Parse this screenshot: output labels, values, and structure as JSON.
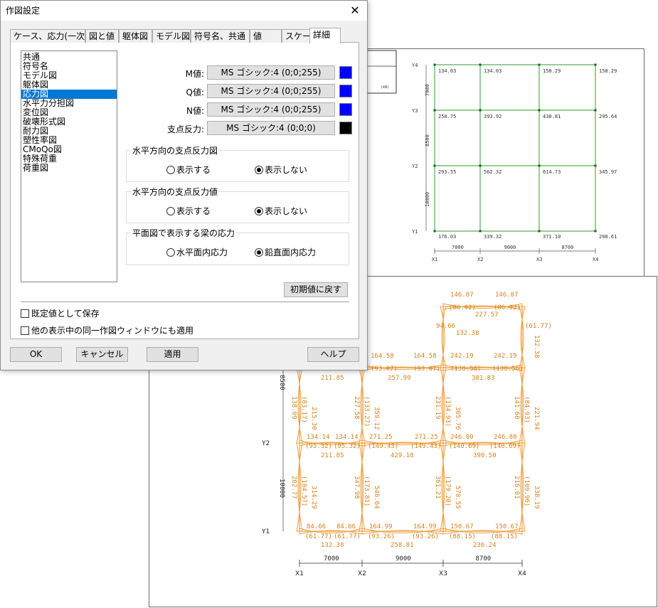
{
  "dialog": {
    "title": "作図設定",
    "close_glyph": "✕",
    "tabs": [
      {
        "label": "ケース、応力(一次)"
      },
      {
        "label": "図と値"
      },
      {
        "label": "躯体図"
      },
      {
        "label": "モデル図"
      },
      {
        "label": "符号名、共通"
      },
      {
        "label": "値"
      },
      {
        "label": "スケール"
      },
      {
        "label": "詳細",
        "active": true
      }
    ],
    "list_items": [
      "共通",
      "符号名",
      "モデル図",
      "躯体図",
      "応力図",
      "水平力分担図",
      "変位図",
      "破壊形式図",
      "耐力図",
      "塑性率図",
      "CMoQo図",
      "特殊荷重",
      "荷重図"
    ],
    "selected_item": "応力図",
    "font_rows": [
      {
        "label": "M値:",
        "font": "MS ゴシック:4 (0;0;255)",
        "color": "#0000ff"
      },
      {
        "label": "Q値:",
        "font": "MS ゴシック:4 (0;0;255)",
        "color": "#0000ff"
      },
      {
        "label": "N値:",
        "font": "MS ゴシック:4 (0;0;255)",
        "color": "#0000ff"
      },
      {
        "label": "支点反力:",
        "font": "MS ゴシック:4 (0;0;0)",
        "color": "#000000"
      }
    ],
    "groups": [
      {
        "title": "水平方向の支点反力図",
        "options": [
          "表示する",
          "表示しない"
        ],
        "selected": 1
      },
      {
        "title": "水平方向の支点反力値",
        "options": [
          "表示する",
          "表示しない"
        ],
        "selected": 1
      },
      {
        "title": "平面図で表示する梁の応力",
        "options": [
          "水平面内応力",
          "鉛直面内応力"
        ],
        "selected": 1
      }
    ],
    "reset_button": "初期値に戻す",
    "checkboxes": [
      "既定値として保存",
      "他の表示中の同一作図ウィンドウにも適用"
    ],
    "buttons": {
      "ok": "OK",
      "cancel": "キャンセル",
      "apply": "適用",
      "help": "ヘルプ"
    }
  },
  "top_drawing": {
    "y_labels": [
      "Y4",
      "Y3",
      "Y2",
      "Y1"
    ],
    "x_labels": [
      "X1",
      "X2",
      "X3",
      "X4"
    ],
    "y_dims": [
      "7000",
      "8500",
      "10000"
    ],
    "x_dims": [
      "7000",
      "9000",
      "8700"
    ],
    "node_values": [
      [
        "134.03",
        "134.03",
        "158.29",
        "158.29"
      ],
      [
        "250.75",
        "393.92",
        "438.81",
        "295.64"
      ],
      [
        "293.55",
        "562.32",
        "614.73",
        "345.97"
      ],
      [
        "176.03",
        "339.32",
        "371.10",
        "208.61"
      ]
    ],
    "legend_text": "(kN)",
    "line_color": "#2e9b2e"
  },
  "bottom_drawing": {
    "y_labels": [
      "Y2",
      "Y1"
    ],
    "x_labels": [
      "X1",
      "X2",
      "X3",
      "X4"
    ],
    "y_dims": [
      "8500",
      "10000"
    ],
    "x_dims": [
      "7000",
      "9000",
      "8700"
    ],
    "moment_color": "#f0a040",
    "value_color": "#d4821e",
    "values": [
      "146.07",
      "146.07",
      "(86.02)",
      "(86.02)",
      "227.57",
      "164.58",
      "164.58",
      "242.19",
      "242.19",
      "(93.07)",
      "(93.07)",
      "(138.56)",
      "(138.56)",
      "211.85",
      "257.99",
      "381.83",
      "138.09",
      "(83.17)",
      "215.30",
      "227.58",
      "(133.27)",
      "359.12",
      "231.19",
      "(134.93)",
      "305.76",
      "141.60",
      "(84.93)",
      "221.94",
      "134.14",
      "134.14",
      "271.25",
      "271.25",
      "246.80",
      "246.80",
      "(95.32)",
      "(95.32)",
      "(149.43)",
      "(149.43)",
      "(140.69)",
      "(140.69)",
      "211.85",
      "429.18",
      "390.50",
      "202.77",
      "(104.57)",
      "314.29",
      "347.98",
      "(173.81)",
      "546.64",
      "361.21",
      "(179.20)",
      "570.55",
      "216.01",
      "(109.96)",
      "338.19",
      "84.66",
      "84.66",
      "164.99",
      "164.99",
      "150.67",
      "150.67",
      "(61.77)",
      "(61.77)",
      "(93.26)",
      "(93.26)",
      "(88.15)",
      "(88.15)",
      "132.38",
      "258.81",
      "236.24",
      "94.66",
      "(61.77)",
      "132.38",
      "132.38"
    ]
  }
}
